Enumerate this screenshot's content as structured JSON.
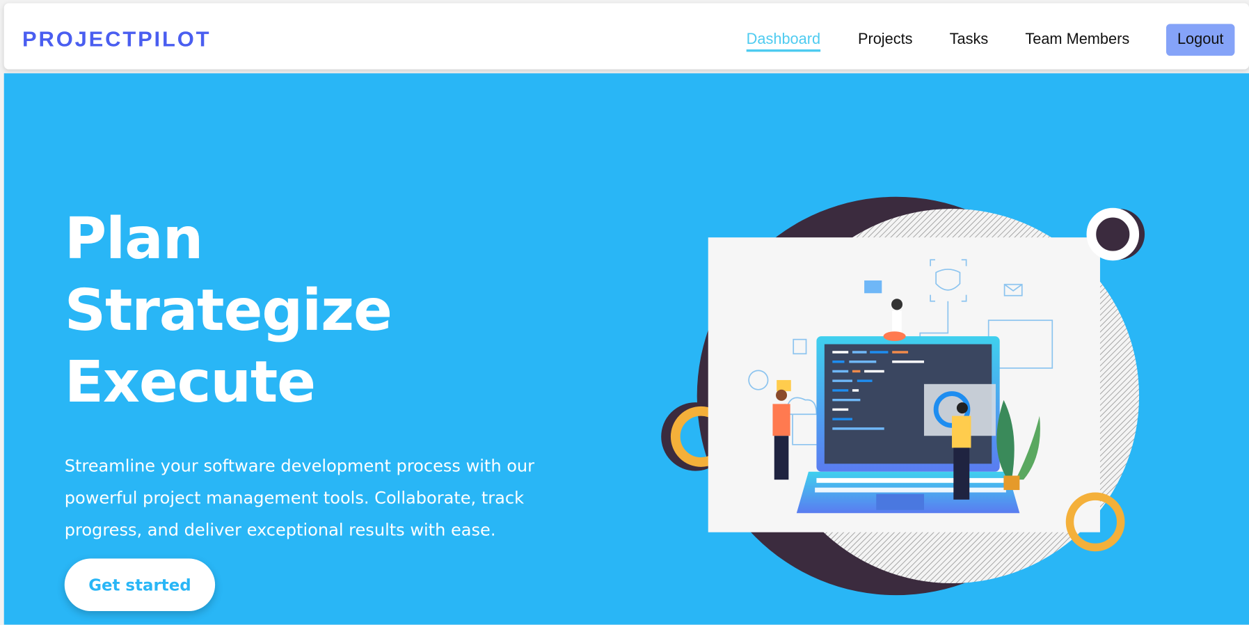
{
  "navbar": {
    "logo": "PROJECTPILOT",
    "links": [
      {
        "label": "Dashboard",
        "active": true
      },
      {
        "label": "Projects"
      },
      {
        "label": "Tasks"
      },
      {
        "label": "Team Members"
      }
    ],
    "logout_label": "Logout"
  },
  "hero": {
    "headline": [
      "Plan",
      "Strategize",
      "Execute"
    ],
    "description": "Streamline your software development process with our powerful project management tools. Collaborate, track progress, and deliver exceptional results with ease.",
    "cta_label": "Get started"
  },
  "colors": {
    "brand": "#4a5ef0",
    "hero_bg": "#29b6f6",
    "accent": "#4ecbf0",
    "logout_bg": "#85a3f8"
  }
}
